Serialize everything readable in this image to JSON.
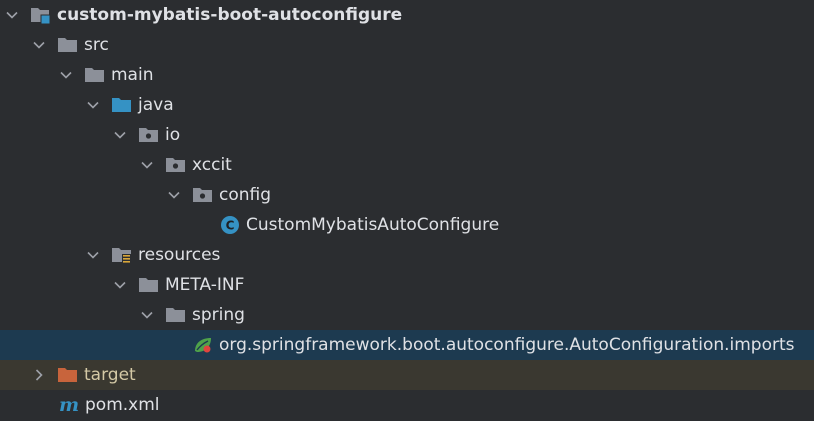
{
  "tree": {
    "root": {
      "label": "custom-mybatis-boot-autoconfigure",
      "icon": "module-folder-icon"
    },
    "src": {
      "label": "src",
      "icon": "folder-icon"
    },
    "main": {
      "label": "main",
      "icon": "folder-icon"
    },
    "java": {
      "label": "java",
      "icon": "source-root-folder-icon"
    },
    "io": {
      "label": "io",
      "icon": "package-folder-icon"
    },
    "xccit": {
      "label": "xccit",
      "icon": "package-folder-icon"
    },
    "config": {
      "label": "config",
      "icon": "package-folder-icon"
    },
    "class": {
      "label": "CustomMybatisAutoConfigure",
      "icon": "class-icon",
      "badge": "C"
    },
    "resources": {
      "label": "resources",
      "icon": "resources-folder-icon"
    },
    "metainf": {
      "label": "META-INF",
      "icon": "folder-icon"
    },
    "spring": {
      "label": "spring",
      "icon": "folder-icon"
    },
    "imports": {
      "label": "org.springframework.boot.autoconfigure.AutoConfiguration.imports",
      "icon": "spring-file-icon"
    },
    "target": {
      "label": "target",
      "icon": "excluded-folder-icon"
    },
    "pom": {
      "label": "pom.xml",
      "icon": "maven-icon",
      "badge": "m"
    }
  },
  "colors": {
    "background": "#2b2d30",
    "selected_row": "#1d3a50",
    "excluded_row": "#3a3830",
    "folder": "#8c9099",
    "source_folder": "#3592c4",
    "excluded_folder": "#c8643c",
    "class_icon": "#3592c4",
    "maven": "#3592c4"
  }
}
